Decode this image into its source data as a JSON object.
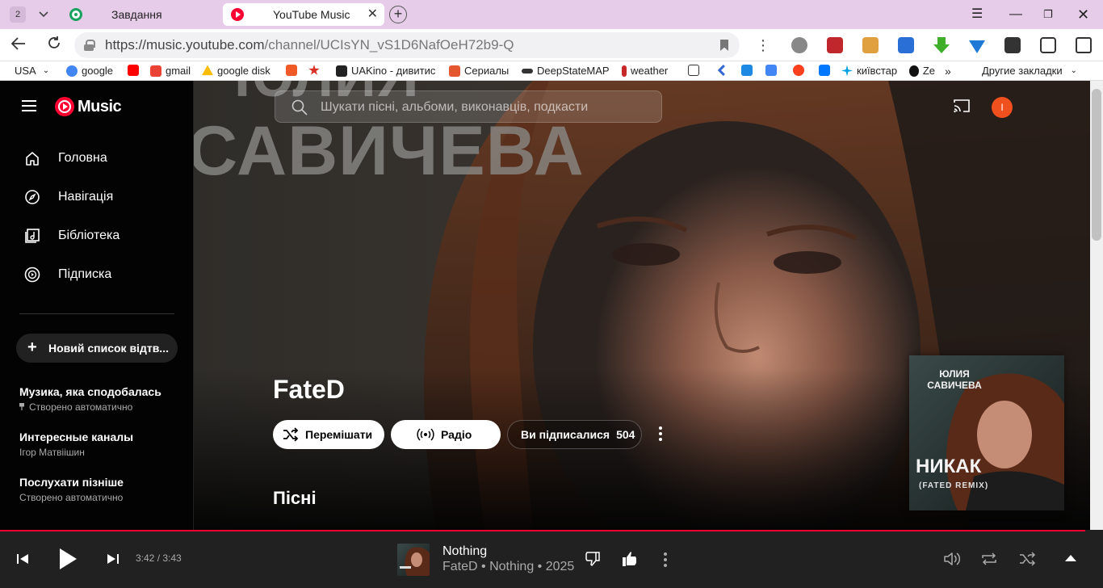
{
  "browser": {
    "tab_count": "2",
    "tabs": [
      {
        "title": "Завдання"
      },
      {
        "title": "YouTube Music"
      }
    ],
    "url": {
      "host": "https://music.youtube.com",
      "path": "/channel/UCIsYN_vS1D6NafOeH72b9-Q"
    },
    "bookmarks": [
      {
        "label": "USA",
        "icon": "chevron-down-icon"
      },
      {
        "label": "google",
        "icon": "google-icon"
      },
      {
        "label": "",
        "icon": "youtube-icon"
      },
      {
        "label": "gmail",
        "icon": "gmail-icon"
      },
      {
        "label": "google disk",
        "icon": "google-drive-icon"
      },
      {
        "label": "UAKino - дивитис",
        "icon": "uakino-icon"
      },
      {
        "label": "Сериалы",
        "icon": "series-icon"
      },
      {
        "label": "DeepStateMAP",
        "icon": "deepstate-icon"
      },
      {
        "label": "weather",
        "icon": "thermometer-icon"
      },
      {
        "label": "київстар",
        "icon": "kyivstar-icon"
      },
      {
        "label": "Ze",
        "icon": "ze-icon"
      },
      {
        "label": "Другие закладки",
        "icon": "folder-icon"
      }
    ]
  },
  "app": {
    "logo_text": "Music",
    "search_placeholder": "Шукати пісні, альбоми, виконавців, подкасти",
    "avatar_letter": "I",
    "nav": [
      {
        "label": "Головна",
        "icon": "home-icon"
      },
      {
        "label": "Навігація",
        "icon": "compass-icon"
      },
      {
        "label": "Бібліотека",
        "icon": "library-icon"
      },
      {
        "label": "Підписка",
        "icon": "subscription-icon"
      }
    ],
    "new_playlist_label": "Новий список відтв...",
    "playlists": [
      {
        "title": "Музика, яка сподобалась",
        "subtitle": "Створено автоматично",
        "pinned": true
      },
      {
        "title": "Интересные каналы",
        "subtitle": "Ігор Матвіішин",
        "pinned": false
      },
      {
        "title": "Послухати пізніше",
        "subtitle": "Створено автоматично",
        "pinned": false
      }
    ],
    "banner": {
      "line1": "ЮЛИЯ",
      "line2": "САВИЧЕВА"
    },
    "artist": {
      "name": "FateD",
      "shuffle_label": "Перемішати",
      "radio_label": "Радіо",
      "subscribed_label": "Ви підписалися",
      "subscriber_count": "504",
      "songs_heading": "Пісні"
    },
    "album_cover": {
      "artist": "ЮЛИЯ САВИЧЕВА",
      "title": "НИКАК",
      "subtitle": "(FATED REMIX)"
    },
    "player": {
      "time_current": "3:42",
      "time_total": "3:43",
      "time_sep": " / ",
      "track_title": "Nothing",
      "track_meta": "FateD • Nothing • 2025",
      "progress": 0.996
    }
  }
}
